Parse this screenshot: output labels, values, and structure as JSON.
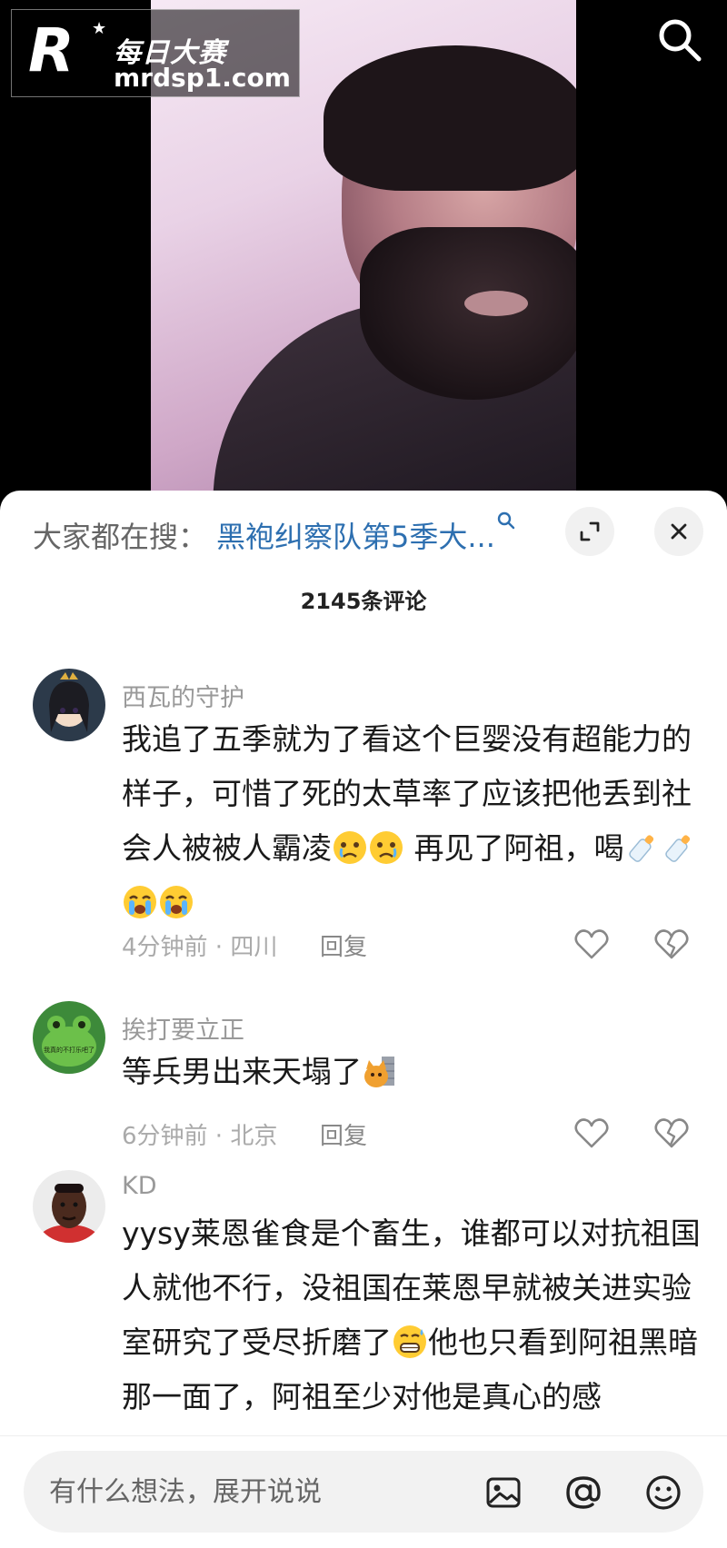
{
  "watermark": {
    "mark": "R",
    "brand_cn": "每日大赛",
    "brand_url": "mrdsp1.com"
  },
  "header": {
    "search_icon": "search-icon"
  },
  "sheet": {
    "search_prefix": "大家都在搜：",
    "search_term": "黑袍纠察队第5季大...",
    "expand_icon": "expand-icon",
    "close_icon": "close-icon",
    "comment_count": "2145条评论"
  },
  "comments": [
    {
      "user": "西瓦的守护",
      "text_1": "我追了五季就为了看这个巨婴没有超能力的样子，可惜了死的太草率了应该把他丢到社会人被被人霸凌",
      "text_2": "  再见了阿祖，喝",
      "meta": "4分钟前 · 四川",
      "reply": "回复"
    },
    {
      "user": "挨打要立正",
      "text_1": "等兵男出来天塌了",
      "avatar_caption": "我真的不打乐吧了",
      "meta": "6分钟前 · 北京",
      "reply": "回复"
    },
    {
      "user": "KD",
      "text_1": "yysy莱恩雀食是个畜生，谁都可以对抗祖国人就他不行，没祖国在莱恩早就被关进实验室研究了受尽折磨了",
      "text_2": "他也只看到阿祖黑暗那一面了，阿祖至少对他是真心的感"
    }
  ],
  "input_bar": {
    "placeholder": "有什么想法，展开说说",
    "image_icon": "image-icon",
    "mention_icon": "at-icon",
    "emoji_icon": "emoji-icon"
  },
  "colors": {
    "link": "#2d6fb0",
    "meta_text": "#aaaaaa",
    "username": "#999999"
  }
}
